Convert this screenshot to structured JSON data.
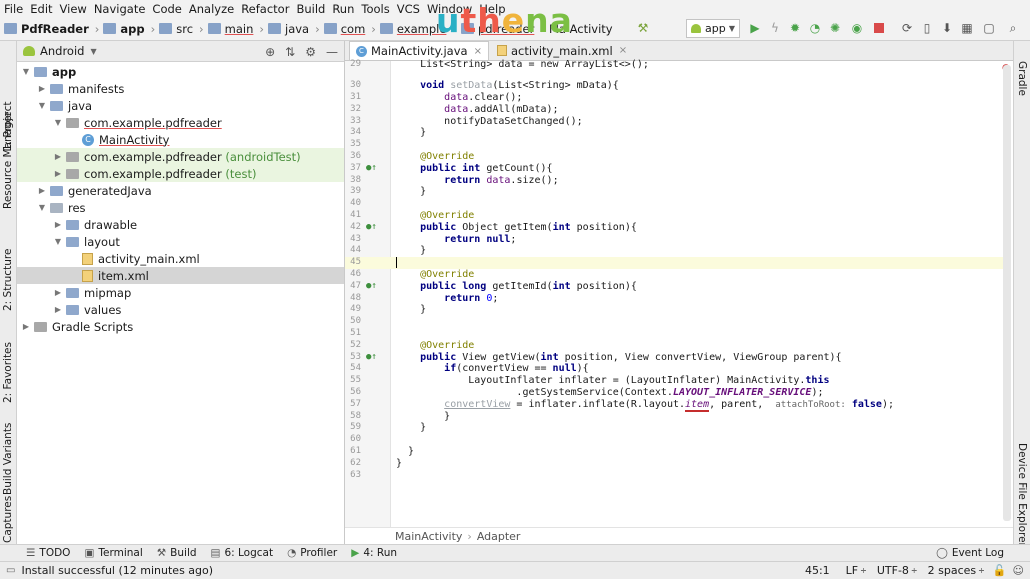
{
  "menu": [
    "File",
    "Edit",
    "View",
    "Navigate",
    "Code",
    "Analyze",
    "Refactor",
    "Build",
    "Run",
    "Tools",
    "VCS",
    "Window",
    "Help"
  ],
  "logo": [
    "u",
    "th",
    "e",
    "na"
  ],
  "breadcrumbs": [
    "PdfReader",
    "app",
    "src",
    "main",
    "java",
    "com",
    "example",
    "pdfreader"
  ],
  "breadcrumb_tail": "Ma Activity",
  "run_config": "app",
  "left_tabs": [
    "1: Project",
    "Resource Manager",
    "2: Structure",
    "2: Favorites",
    "Build Variants",
    "Captures"
  ],
  "right_tabs": [
    "Gradle",
    "Device File Explorer"
  ],
  "project": {
    "view": "Android",
    "tree": [
      {
        "label": "app",
        "suffix": ""
      },
      {
        "label": "manifests",
        "suffix": ""
      },
      {
        "label": "java",
        "suffix": ""
      },
      {
        "label": "com.example.pdfreader",
        "suffix": ""
      },
      {
        "label": "MainActivity",
        "suffix": ""
      },
      {
        "label": "com.example.pdfreader",
        "suffix": "(androidTest)"
      },
      {
        "label": "com.example.pdfreader",
        "suffix": "(test)"
      },
      {
        "label": "generatedJava",
        "suffix": ""
      },
      {
        "label": "res",
        "suffix": ""
      },
      {
        "label": "drawable",
        "suffix": ""
      },
      {
        "label": "layout",
        "suffix": ""
      },
      {
        "label": "activity_main.xml",
        "suffix": ""
      },
      {
        "label": "item.xml",
        "suffix": ""
      },
      {
        "label": "mipmap",
        "suffix": ""
      },
      {
        "label": "values",
        "suffix": ""
      },
      {
        "label": "Gradle Scripts",
        "suffix": ""
      }
    ]
  },
  "tabs": [
    {
      "label": "MainActivity.java"
    },
    {
      "label": "activity_main.xml"
    }
  ],
  "code": {
    "l29": "List<String> data = new ArrayList<>();",
    "l30a": "void ",
    "l30b": "setData",
    "l30c": "(List<String> mData){",
    "l31a": "data",
    "l31b": ".clear();",
    "l32a": "data",
    "l32b": ".addAll(mData);",
    "l33": "notifyDataSetChanged();",
    "l34": "}",
    "l36": "@Override",
    "l37a": "public int ",
    "l37b": "getCount(){",
    "l38a": "return ",
    "l38b": "data",
    "l38c": ".size();",
    "l39": "}",
    "l41": "@Override",
    "l42a": "public ",
    "l42b": "Object getItem(",
    "l42c": "int ",
    "l42d": "position){",
    "l43a": "return null",
    "l43b": ";",
    "l44": "}",
    "l46": "@Override",
    "l47a": "public long ",
    "l47b": "getItemId(",
    "l47c": "int ",
    "l47d": "position){",
    "l48a": "return ",
    "l48b": "0",
    "l48c": ";",
    "l49": "}",
    "l52": "@Override",
    "l53a": "public ",
    "l53b": "View getView(",
    "l53c": "int ",
    "l53d": "position, View convertView, ViewGroup parent){",
    "l54a": "if",
    "l54b": "(convertView == ",
    "l54c": "null",
    "l54d": "){",
    "l55a": "LayoutInflater inflater = (LayoutInflater) MainActivity.",
    "l55b": "this",
    "l56a": ".getSystemService(Context.",
    "l56b": "LAYOUT_INFLATER_SERVICE",
    "l56c": ");",
    "l57a": "convertView",
    "l57b": " = inflater.inflate(R.layout.",
    "l57c": "item",
    "l57d": ", parent, ",
    "l57e": "attachToRoot:",
    "l57f": " false",
    "l57g": ");",
    "l58": "}",
    "l59": "}",
    "l61": "}",
    "l62": "}"
  },
  "editor_breadcrumb": [
    "MainActivity",
    "Adapter"
  ],
  "tool_windows": [
    "TODO",
    "Terminal",
    "Build",
    "6: Logcat",
    "Profiler",
    "4: Run"
  ],
  "event_log": "Event Log",
  "status": {
    "message": "Install successful (12 minutes ago)",
    "position": "45:1",
    "line_sep": "LF",
    "encoding": "UTF-8",
    "indent": "2 spaces"
  }
}
